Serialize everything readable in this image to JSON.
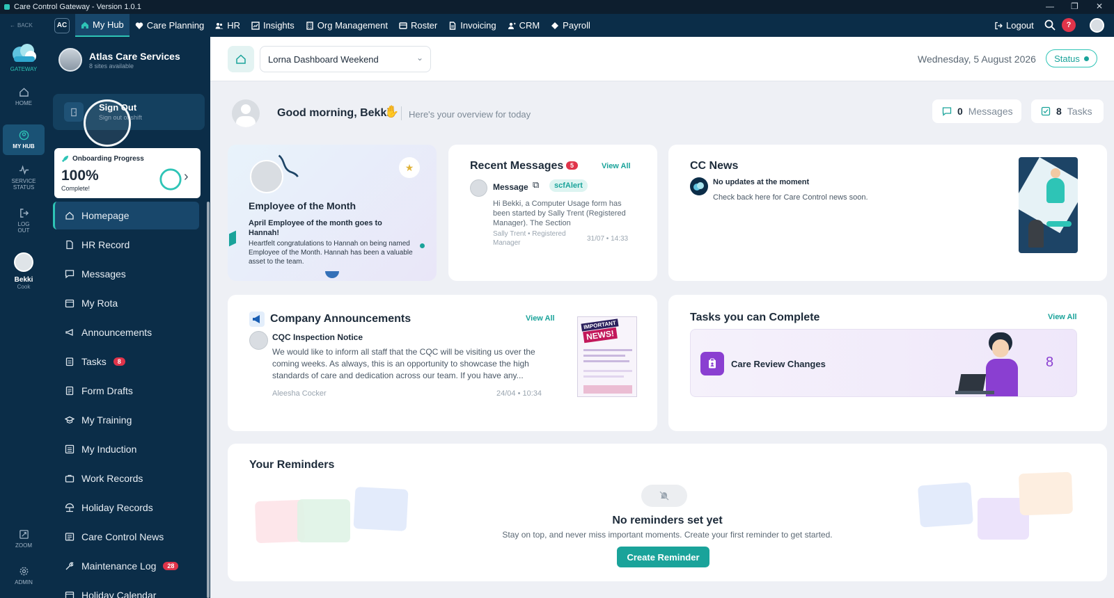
{
  "window": {
    "title": "Care Control Gateway - Version 1.0.1"
  },
  "topnav": {
    "org_initials": "AC",
    "items": [
      {
        "label": "My Hub",
        "icon": "home-icon"
      },
      {
        "label": "Care Planning",
        "icon": "heart-icon"
      },
      {
        "label": "HR",
        "icon": "users-icon"
      },
      {
        "label": "Insights",
        "icon": "chart-icon"
      },
      {
        "label": "Org Management",
        "icon": "building-icon"
      },
      {
        "label": "Roster",
        "icon": "roster-icon"
      },
      {
        "label": "Invoicing",
        "icon": "document-icon"
      },
      {
        "label": "CRM",
        "icon": "contact-icon"
      },
      {
        "label": "Payroll",
        "icon": "payroll-icon"
      }
    ],
    "logout_label": "Logout",
    "help_label": "?"
  },
  "rail": {
    "back_label": "BACK",
    "logo_label": "GATEWAY",
    "home_label": "HOME",
    "myhub_label": "MY HUB",
    "service_label": "SERVICE STATUS",
    "logout_label": "LOG OUT",
    "user_name": "Bekki",
    "user_role": "Cook",
    "zoom_label": "ZOOM",
    "admin_label": "ADMIN"
  },
  "sidebar": {
    "org_name": "Atlas Care Services",
    "org_sites": "8 sites available",
    "signout_title": "Sign Out",
    "signout_sub": "Sign out of shift",
    "onboarding_title": "Onboarding Progress",
    "onboarding_value": "100%",
    "onboarding_sub": "Complete!",
    "onboarding_progress": 1.0,
    "items": [
      {
        "label": "Homepage",
        "badge": ""
      },
      {
        "label": "HR Record",
        "badge": ""
      },
      {
        "label": "Messages",
        "badge": ""
      },
      {
        "label": "My Rota",
        "badge": ""
      },
      {
        "label": "Announcements",
        "badge": ""
      },
      {
        "label": "Tasks",
        "badge": "8"
      },
      {
        "label": "Form Drafts",
        "badge": ""
      },
      {
        "label": "My Training",
        "badge": ""
      },
      {
        "label": "My Induction",
        "badge": ""
      },
      {
        "label": "Work Records",
        "badge": ""
      },
      {
        "label": "Holiday Records",
        "badge": ""
      },
      {
        "label": "Care Control News",
        "badge": ""
      },
      {
        "label": "Maintenance Log",
        "badge": "28"
      },
      {
        "label": "Holiday Calendar",
        "badge": ""
      }
    ]
  },
  "header": {
    "dashboard_select": "Lorna Dashboard Weekend",
    "date": "Wednesday, 5 August 2026",
    "status_label": "Status"
  },
  "greeting": {
    "text": "Good morning, Bekki",
    "sub": "Here's your overview for today",
    "messages_count": "0",
    "messages_label": "Messages",
    "tasks_count": "8",
    "tasks_label": "Tasks"
  },
  "employee": {
    "title": "Employee of the Month",
    "headline": "April Employee of the month goes to Hannah!",
    "body": "Heartfelt congratulations to Hannah on being named Employee of the Month. Hannah has been a valuable asset to the team."
  },
  "recent_messages": {
    "title": "Recent Messages",
    "count": "5",
    "view_all": "View All",
    "item": {
      "type": "Message",
      "tag": "scfAlert",
      "body": "Hi Bekki, a Computer Usage form has been started by Sally Trent (Registered Manager). The Section",
      "author": "Sally Trent • Registered Manager",
      "time": "31/07 • 14:33"
    }
  },
  "cc_news": {
    "title": "CC News",
    "headline": "No updates at the moment",
    "body": "Check back here for Care Control news soon."
  },
  "announcements": {
    "title": "Company Announcements",
    "view_all": "View All",
    "item": {
      "title": "CQC Inspection Notice",
      "body": "We would like to inform all staff that the CQC will be visiting us over the coming weeks. As always, this is an opportunity to showcase the high standards of care and dedication across our team. If you have any...",
      "author": "Aleesha Cocker",
      "time": "24/04 • 10:34"
    },
    "poster_line1": "IMPORTANT",
    "poster_line2": "NEWS!"
  },
  "tasks": {
    "title": "Tasks you can Complete",
    "view_all": "View All",
    "item_label": "Care Review Changes",
    "item_count": "8"
  },
  "reminders": {
    "title": "Your Reminders",
    "empty_title": "No reminders set yet",
    "empty_body": "Stay on top, and never miss important moments. Create your first reminder to get started.",
    "button": "Create Reminder"
  },
  "colors": {
    "navy": "#0b2d48",
    "teal": "#2ec4b6",
    "badge_red": "#e0344a",
    "purple": "#8a3fd1"
  }
}
